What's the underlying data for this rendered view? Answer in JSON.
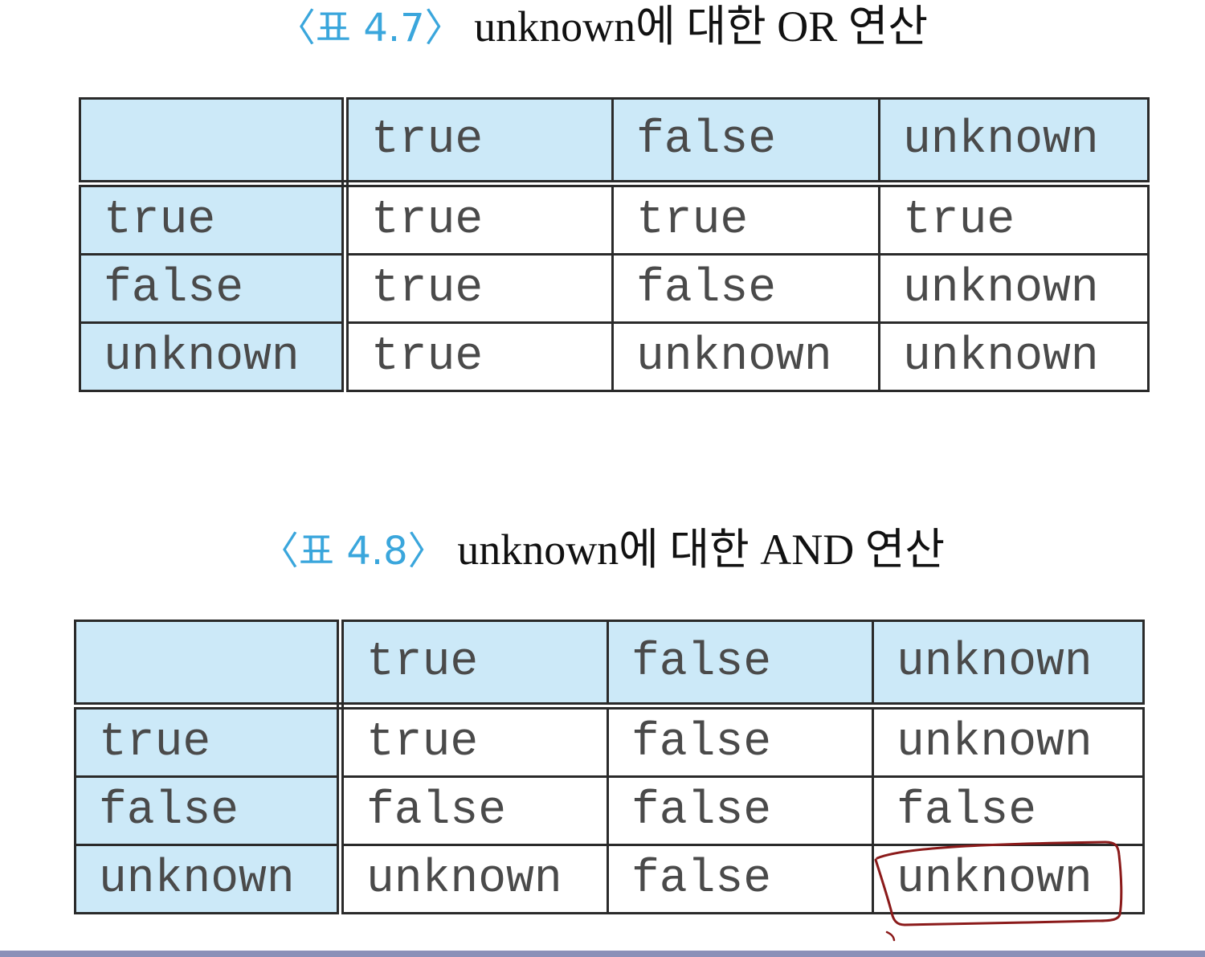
{
  "tables": [
    {
      "caption_label": "〈표 4.7〉",
      "caption_text": "unknown에 대한 OR 연산",
      "columns": [
        "",
        "true",
        "false",
        "unknown"
      ],
      "rows": [
        [
          "true",
          "true",
          "true",
          "true"
        ],
        [
          "false",
          "true",
          "false",
          "unknown"
        ],
        [
          "unknown",
          "true",
          "unknown",
          "unknown"
        ]
      ]
    },
    {
      "caption_label": "〈표 4.8〉",
      "caption_text": "unknown에 대한 AND 연산",
      "columns": [
        "",
        "true",
        "false",
        "unknown"
      ],
      "rows": [
        [
          "true",
          "true",
          "false",
          "unknown"
        ],
        [
          "false",
          "false",
          "false",
          "false"
        ],
        [
          "unknown",
          "unknown",
          "false",
          "unknown"
        ]
      ]
    }
  ],
  "colors": {
    "header_fill": "#cce9f8",
    "caption_label": "#3aa6dc",
    "annotation_ink": "#8b1a1a",
    "bottom_bar": "#8a90b8"
  },
  "annotation": {
    "target": "tables.1.rows.2.3",
    "shape": "hand-drawn-box"
  }
}
